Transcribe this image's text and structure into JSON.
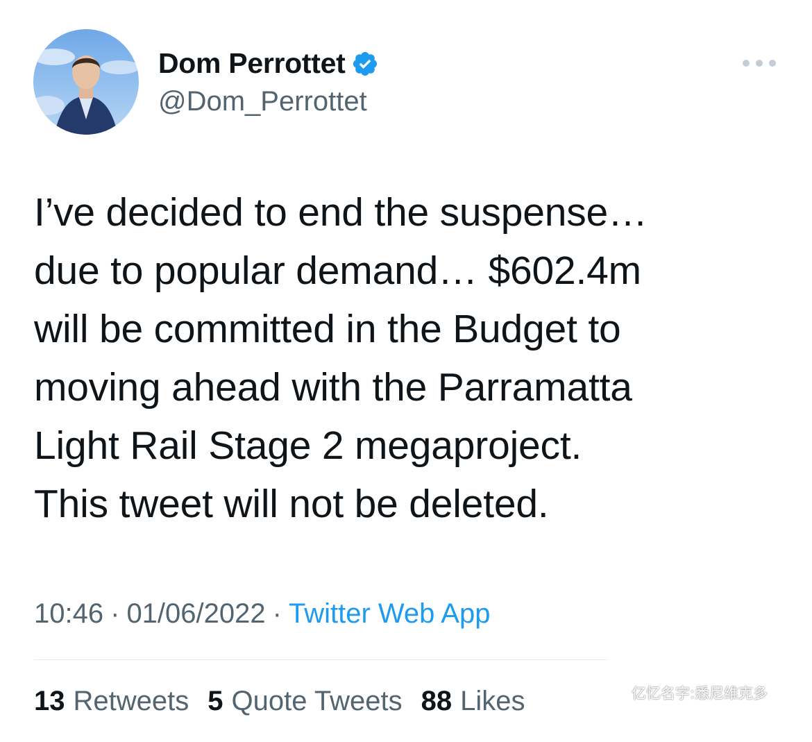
{
  "author": {
    "display_name": "Dom Perrottet",
    "handle": "@Dom_Perrottet",
    "verified": true,
    "verified_color": "#1d9bf0",
    "avatar_icon": "profile-photo"
  },
  "more_icon": "more-horizontal-icon",
  "tweet": {
    "paragraphs": [
      "I’ve decided to end the suspense…\ndue to popular demand… $602.4m\nwill be committed in the Budget to\nmoving ahead with the Parramatta\nLight Rail Stage 2 megaproject.",
      "This tweet will not be deleted."
    ]
  },
  "meta": {
    "time": "10:46",
    "separator": "·",
    "date": "01/06/2022",
    "source": "Twitter Web App"
  },
  "stats": {
    "retweets_count": "13",
    "retweets_label": "Retweets",
    "quotes_count": "5",
    "quotes_label": "Quote Tweets",
    "likes_count": "88",
    "likes_label": "Likes"
  },
  "watermark": "亿忆名字:悉尼维克多",
  "colors": {
    "text": "#0f1419",
    "secondary": "#536471",
    "link": "#1d9bf0"
  }
}
